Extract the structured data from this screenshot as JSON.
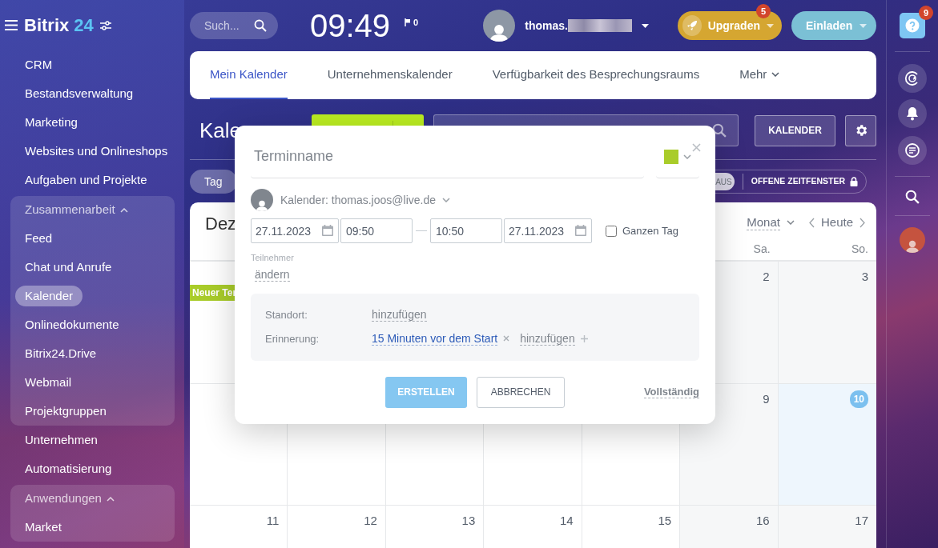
{
  "sidebar": {
    "logo": {
      "name": "Bitrix",
      "number": "24"
    },
    "items": [
      {
        "kind": "link",
        "label": "CRM",
        "selected": false
      },
      {
        "kind": "link",
        "label": "Bestandsverwaltung",
        "selected": false
      },
      {
        "kind": "link",
        "label": "Marketing",
        "selected": false
      },
      {
        "kind": "link",
        "label": "Websites und Onlineshops",
        "selected": false
      },
      {
        "kind": "link",
        "label": "Aufgaben und Projekte",
        "selected": false
      },
      {
        "kind": "group",
        "label": "Zusammenarbeit",
        "expanded": true,
        "children": [
          {
            "kind": "link",
            "label": "Feed",
            "selected": false
          },
          {
            "kind": "link",
            "label": "Chat und Anrufe",
            "selected": false
          },
          {
            "kind": "link",
            "label": "Kalender",
            "selected": true
          },
          {
            "kind": "link",
            "label": "Onlinedokumente",
            "selected": false
          },
          {
            "kind": "link",
            "label": "Bitrix24.Drive",
            "selected": false
          },
          {
            "kind": "link",
            "label": "Webmail",
            "selected": false
          },
          {
            "kind": "link",
            "label": "Projektgruppen",
            "selected": false
          }
        ]
      },
      {
        "kind": "link",
        "label": "Unternehmen",
        "selected": false
      },
      {
        "kind": "link",
        "label": "Automatisierung",
        "selected": false
      },
      {
        "kind": "group",
        "label": "Anwendungen",
        "expanded": true,
        "children": [
          {
            "kind": "link",
            "label": "Market",
            "selected": false
          }
        ]
      }
    ]
  },
  "topbar": {
    "search": {
      "placeholder": "Such..."
    },
    "clock": "09:49",
    "flag_count": "0",
    "user": "thomas.",
    "upgrade": {
      "label": "Upgraden",
      "badge": "5"
    },
    "invite": {
      "label": "Einladen"
    }
  },
  "tabs": [
    {
      "label": "Mein Kalender",
      "selected": true
    },
    {
      "label": "Unternehmenskalender",
      "selected": false
    },
    {
      "label": "Verfügbarkeit des Besprechungsraums",
      "selected": false
    }
  ],
  "more_tab": "Mehr",
  "toolbar": {
    "title": "Kale",
    "calendar_button": "KALENDER"
  },
  "filters": {
    "view": {
      "label": "Tag",
      "selected": true
    },
    "toggle": {
      "label": "AUS",
      "on": false
    },
    "open_slots": "OFFENE ZEITFENSTER"
  },
  "calendar": {
    "month": "Dez",
    "view": "Monat",
    "today_button": "Heute",
    "weekdays": [
      "Sa.",
      "So."
    ],
    "weeks": [
      [
        {
          "kind": "blank",
          "events": [
            {
              "title": "Neuer Ter",
              "color": "#a9cc2a"
            }
          ]
        },
        {
          "kind": "blank"
        },
        {
          "kind": "blank"
        },
        {
          "kind": "blank"
        },
        {
          "kind": "blank"
        },
        {
          "kind": "day",
          "day": "2",
          "today": false
        },
        {
          "kind": "day",
          "day": "3",
          "today": false
        }
      ],
      [
        {
          "kind": "blank"
        },
        {
          "kind": "blank"
        },
        {
          "kind": "blank"
        },
        {
          "kind": "blank"
        },
        {
          "kind": "blank"
        },
        {
          "kind": "day",
          "day": "9",
          "today": false
        },
        {
          "kind": "day",
          "day": "10",
          "today": true
        }
      ],
      [
        {
          "kind": "day",
          "day": "11",
          "today": false
        },
        {
          "kind": "day",
          "day": "12",
          "today": false
        },
        {
          "kind": "day",
          "day": "13",
          "today": false
        },
        {
          "kind": "day",
          "day": "14",
          "today": false
        },
        {
          "kind": "day",
          "day": "15",
          "today": false
        },
        {
          "kind": "day",
          "day": "16",
          "today": false
        },
        {
          "kind": "day",
          "day": "17",
          "today": false
        }
      ]
    ]
  },
  "dialog": {
    "name": {
      "placeholder": "Terminname"
    },
    "color": "#a9cc2a",
    "calendar_label": "Kalender: thomas.joos@live.de",
    "start_date": "27.11.2023",
    "start_time": "09:50",
    "end_time": "10:50",
    "end_date": "27.11.2023",
    "all_day": {
      "label": "Ganzen Tag",
      "checked": false
    },
    "participants_label": "Teilnehmer",
    "participants_link": "ändern",
    "details": [
      {
        "label": "Standort:",
        "values": [
          {
            "kind": "link",
            "text": "hinzufügen"
          }
        ]
      },
      {
        "label": "Erinnerung:",
        "values": [
          {
            "kind": "reminder",
            "text": "15 Minuten vor dem Start"
          },
          {
            "kind": "add",
            "text": "hinzufügen"
          }
        ]
      }
    ],
    "create": {
      "label": "ERSTELLEN",
      "disabled": true
    },
    "cancel": "ABBRECHEN",
    "full": "Vollständig"
  },
  "right_panel": {
    "help_badge": "9"
  }
}
